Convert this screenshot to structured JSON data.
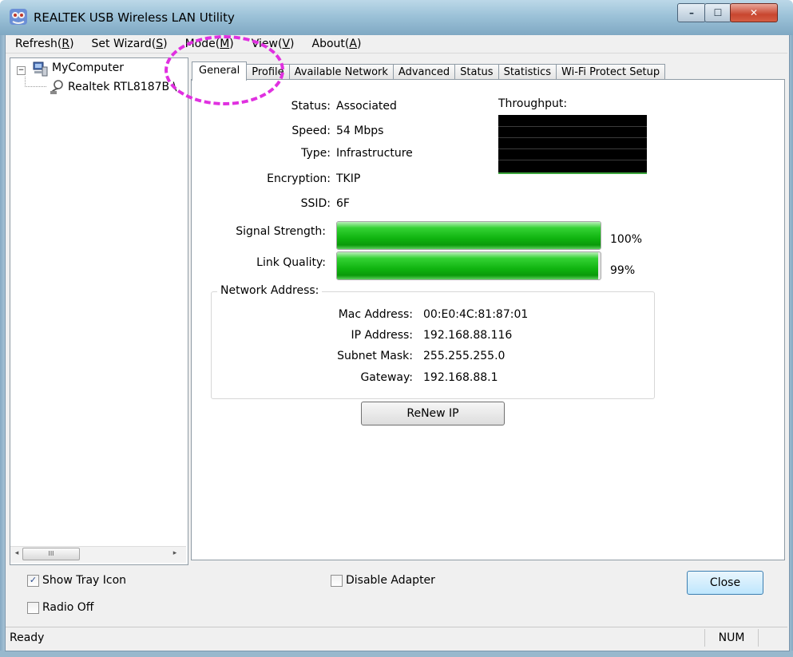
{
  "window": {
    "title": "REALTEK USB Wireless LAN Utility",
    "minimize_label": "–",
    "maximize_label": "☐",
    "close_label": "✕"
  },
  "menu": {
    "items": [
      {
        "label": "Refresh",
        "accel": "R"
      },
      {
        "label": "Set Wizard",
        "accel": "S"
      },
      {
        "label": "Mode",
        "accel": "M"
      },
      {
        "label": "View",
        "accel": "V"
      },
      {
        "label": "About",
        "accel": "A"
      }
    ]
  },
  "tree": {
    "root": "MyComputer",
    "expander": "−",
    "child": "Realtek RTL8187B \\",
    "scroll_thumb": "III",
    "scroll_left": "◂",
    "scroll_right": "▸"
  },
  "tabs": [
    {
      "label": "General",
      "active": true
    },
    {
      "label": "Profile"
    },
    {
      "label": "Available Network"
    },
    {
      "label": "Advanced"
    },
    {
      "label": "Status"
    },
    {
      "label": "Statistics"
    },
    {
      "label": "Wi-Fi Protect Setup"
    }
  ],
  "general": {
    "status_label": "Status:",
    "status_value": "Associated",
    "speed_label": "Speed:",
    "speed_value": "54 Mbps",
    "type_label": "Type:",
    "type_value": "Infrastructure",
    "encryption_label": "Encryption:",
    "encryption_value": "TKIP",
    "ssid_label": "SSID:",
    "ssid_value": "6F",
    "throughput_label": "Throughput:",
    "signal_label": "Signal Strength:",
    "signal_value_text": "100%",
    "signal_percent": 100,
    "link_label": "Link Quality:",
    "link_value_text": "99%",
    "link_percent": 99
  },
  "network_address": {
    "legend": "Network Address:",
    "mac_label": "Mac Address:",
    "mac_value": "00:E0:4C:81:87:01",
    "ip_label": "IP Address:",
    "ip_value": "192.168.88.116",
    "subnet_label": "Subnet Mask:",
    "subnet_value": "255.255.255.0",
    "gateway_label": "Gateway:",
    "gateway_value": "192.168.88.1",
    "renew_label": "ReNew IP"
  },
  "options": {
    "show_tray_label": "Show Tray Icon",
    "show_tray_checked": true,
    "radio_off_label": "Radio Off",
    "radio_off_checked": false,
    "disable_adapter_label": "Disable Adapter",
    "disable_adapter_checked": false,
    "check_mark": "✓",
    "close_label": "Close"
  },
  "statusbar": {
    "text": "Ready",
    "num": "NUM"
  },
  "colors": {
    "annotation": "#e030e0",
    "bar_green": "#10b410"
  }
}
